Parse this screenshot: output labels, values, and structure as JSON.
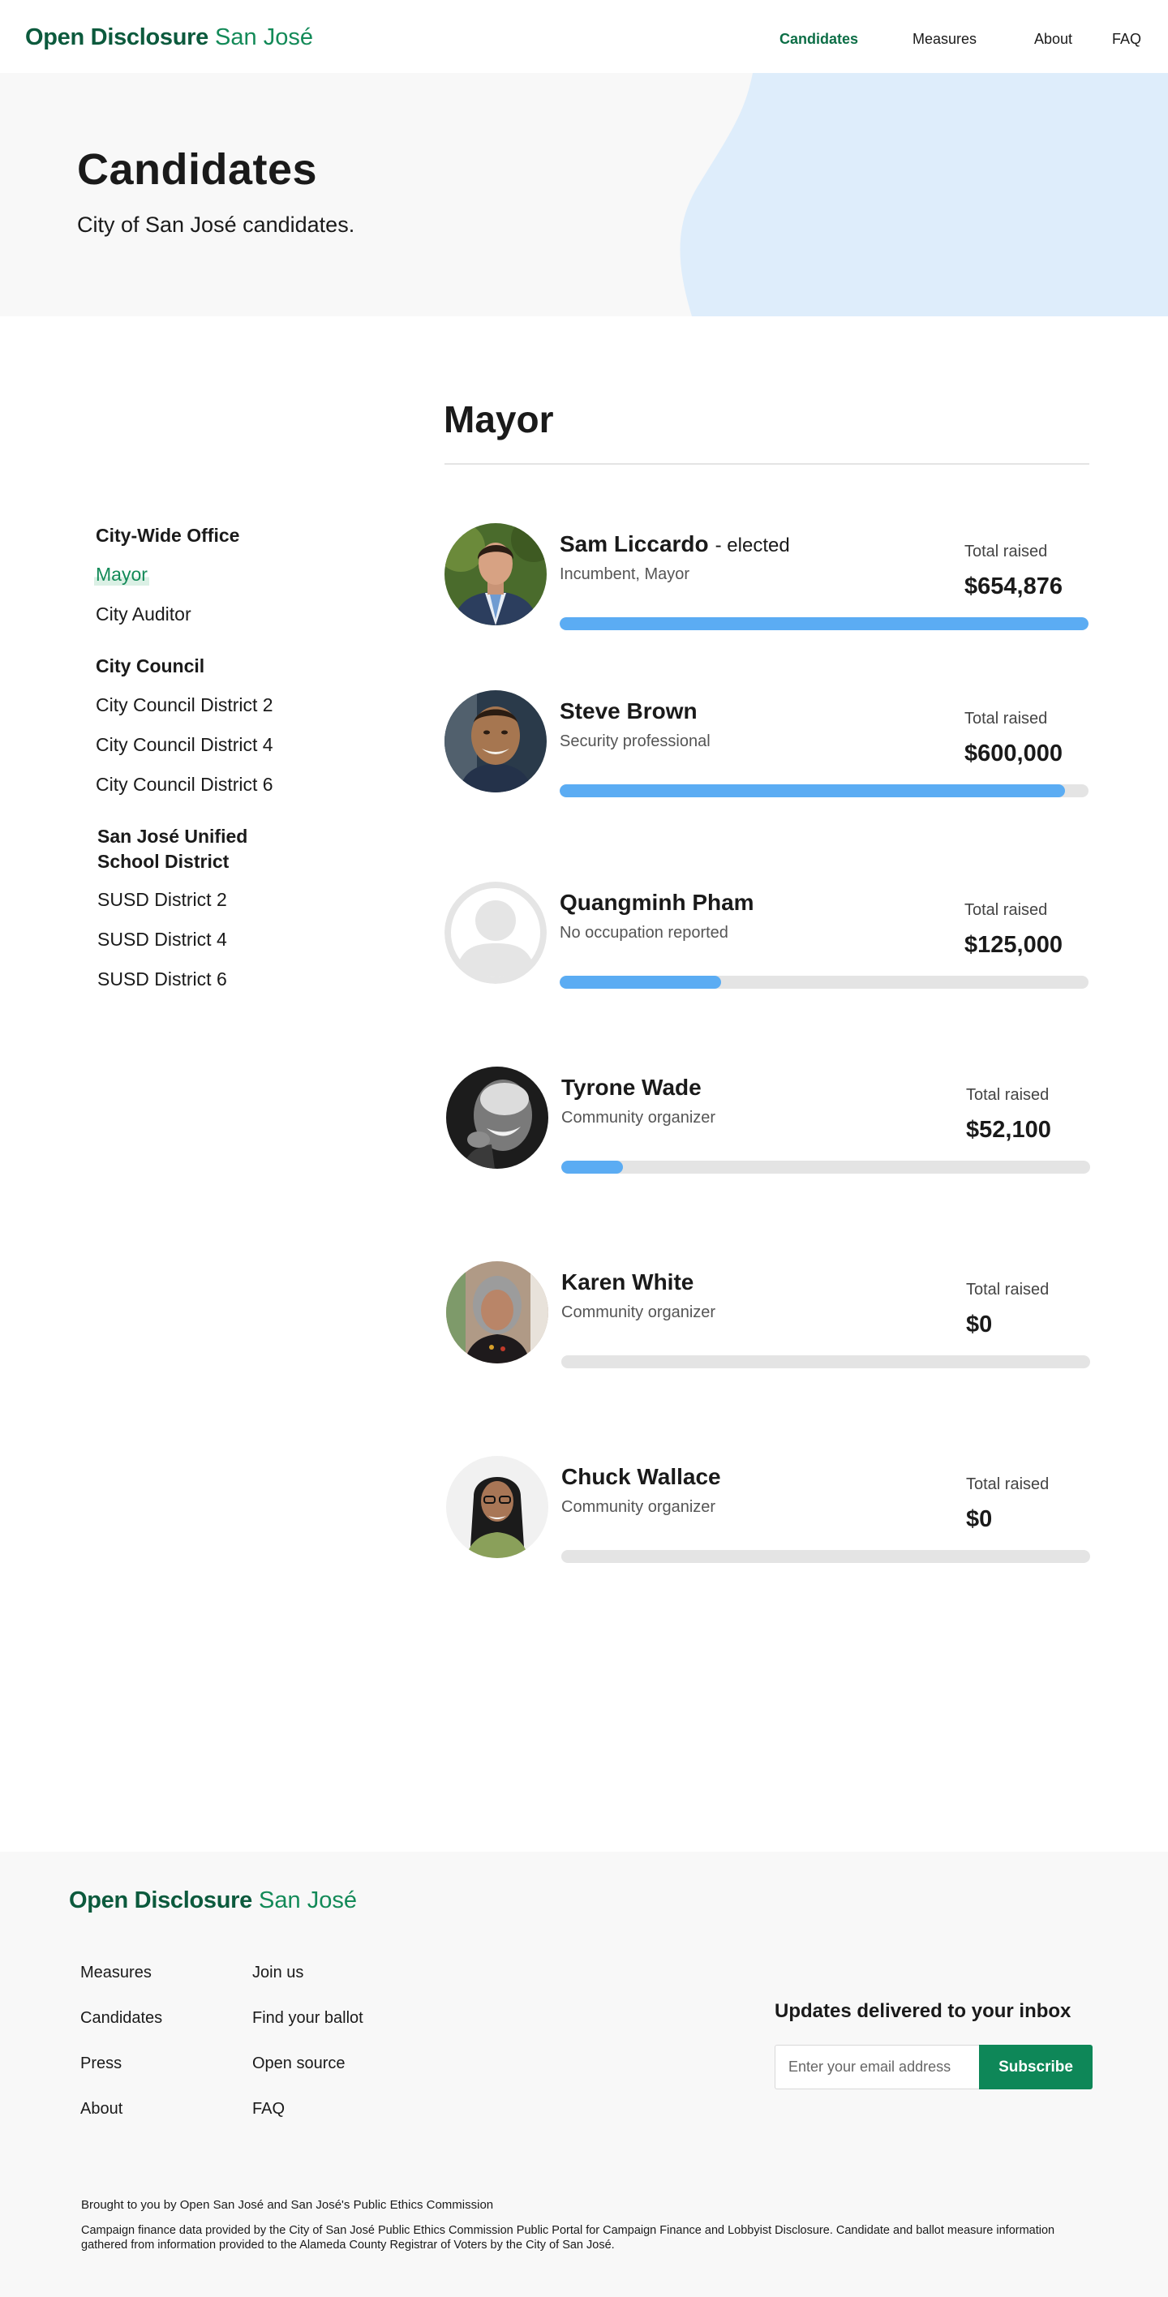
{
  "header": {
    "logo_bold": "Open Disclosure",
    "logo_normal": "San José",
    "nav": [
      "Candidates",
      "Measures",
      "About",
      "FAQ"
    ]
  },
  "hero": {
    "title": "Candidates",
    "subtitle": "City of San José candidates."
  },
  "sidebar": {
    "groups": [
      {
        "heading": "City-Wide Office",
        "items": [
          "Mayor",
          "City Auditor"
        ]
      },
      {
        "heading": "City Council",
        "items": [
          "City Council District 2",
          "City Council District 4",
          "City Council District 6"
        ]
      },
      {
        "heading_line1": "San José Unified",
        "heading_line2": "School District",
        "items": [
          "SUSD District 2",
          "SUSD District 4",
          "SUSD District 6"
        ]
      }
    ],
    "active": "Mayor"
  },
  "main": {
    "title": "Mayor",
    "raised_label": "Total raised",
    "candidates": [
      {
        "name": "Sam Liccardo",
        "status": "- elected",
        "occupation": "Incumbent, Mayor",
        "amount": "$654,876",
        "progress": 1.0,
        "photo": "photo-sam-liccardo"
      },
      {
        "name": "Steve Brown",
        "status": "",
        "occupation": "Security professional",
        "amount": "$600,000",
        "progress": 0.956,
        "photo": "photo-steve-brown"
      },
      {
        "name": "Quangminh Pham",
        "status": "",
        "occupation": "No occupation reported",
        "amount": "$125,000",
        "progress": 0.305,
        "photo": "avatar-placeholder"
      },
      {
        "name": "Tyrone Wade",
        "status": "",
        "occupation": "Community organizer",
        "amount": "$52,100",
        "progress": 0.117,
        "photo": "photo-tyrone-wade"
      },
      {
        "name": "Karen White",
        "status": "",
        "occupation": "Community organizer",
        "amount": "$0",
        "progress": 0,
        "photo": "photo-karen-white"
      },
      {
        "name": "Chuck Wallace",
        "status": "",
        "occupation": "Community organizer",
        "amount": "$0",
        "progress": 0,
        "photo": "photo-chuck-wallace"
      }
    ]
  },
  "footer": {
    "logo_bold": "Open Disclosure",
    "logo_normal": "San José",
    "col1": [
      "Measures",
      "Candidates",
      "Press",
      "About"
    ],
    "col2": [
      "Join us",
      "Find your ballot",
      "Open source",
      "FAQ"
    ],
    "newsletter_title": "Updates delivered to your inbox",
    "email_placeholder": "Enter your email address",
    "subscribe_label": "Subscribe",
    "credit": "Brought to you by Open San José and San José's Public Ethics Commission",
    "disclaimer": "Campaign finance data provided by the City of San José Public Ethics Commission Public Portal for Campaign Finance and Lobbyist Disclosure. Candidate and ballot measure information gathered from information provided to the Alameda County Registrar of Voters by the City of San José."
  },
  "colors": {
    "brand_dark": "#0c5a3d",
    "brand": "#138a58",
    "progress": "#5bacf3",
    "progress_track": "#e4e4e4",
    "hero_blob": "#deedfb",
    "subscribe": "#0e8758"
  }
}
